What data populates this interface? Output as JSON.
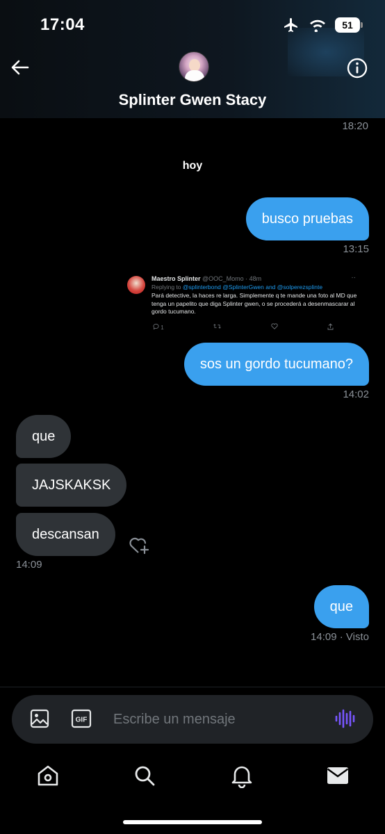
{
  "status_bar": {
    "time": "17:04",
    "battery": "51"
  },
  "header": {
    "contact_name": "Splinter Gwen Stacy",
    "prev_timestamp": "18:20"
  },
  "day_separator": "hoy",
  "messages": [
    {
      "text": "busco pruebas",
      "time": "13:15"
    },
    {
      "text": "sos un gordo tucumano?",
      "time": "14:02"
    },
    {
      "text": "que"
    },
    {
      "text": "JAJSKAKSK"
    },
    {
      "text": "descansan",
      "time": "14:09"
    },
    {
      "text": "que",
      "time": "14:09",
      "status": "· Visto"
    }
  ],
  "tweet": {
    "author": "Maestro Splinter",
    "handle_time": "@OOC_Momo · 48m",
    "replying_prefix": "Replying to",
    "mentions": "@splinterbond @SplinterGwen and @solperezsplinte",
    "body": "Pará detective, la haces re larga. Simplemente q te mande una foto al MD que tenga un papelito que diga Splinter gwen, o se procederá a desenmascarar al gordo tucumano.",
    "reply_count": "1",
    "more": "··"
  },
  "composer": {
    "placeholder": "Escribe un mensaje"
  },
  "colors": {
    "accent": "#3aa0ee",
    "incoming_bubble": "#2f3337",
    "mic": "#7856ff"
  }
}
